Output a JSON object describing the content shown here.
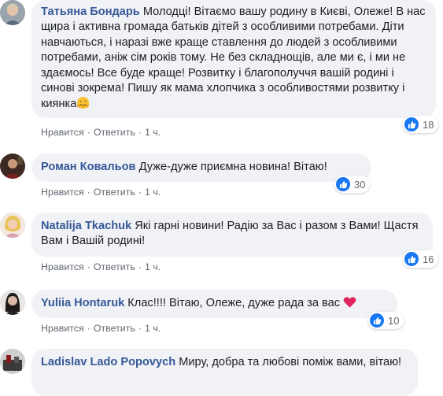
{
  "actions": {
    "like": "Нравится",
    "reply": "Ответить",
    "separator": "·"
  },
  "comments": [
    {
      "author": "Татьяна Бондарь",
      "text": "Молодці! Вітаємо вашу родину в Києві, Олеже! В нас щира і активна громада батьків дітей з особливими потребами. Діти навчаються, і наразі вже краще ставлення до людей з особливими потребами, аніж сім років тому. Не без складнощів, але ми є, і ми не здаємось! Все буде краще! Розвитку і благополуччя вашій родині і синові зокрема! Пишу як мама хлопчика з особливостями розвитку і киянка",
      "emoji": "hugging-face-icon",
      "time": "1 ч.",
      "reactions": "18"
    },
    {
      "author": "Роман Ковальов",
      "text": "Дуже-дуже приємна новина! Вітаю!",
      "time": "1 ч.",
      "reactions": "30"
    },
    {
      "author": "Natalija Tkachuk",
      "text": "Які гарні новини! Радію за Вас і разом з Вами! Щастя Вам і Вашій родині!",
      "time": "1 ч.",
      "reactions": "16"
    },
    {
      "author": "Yuliia Hontaruk",
      "text": "Клас!!!! Вітаю, Олеже, дуже рада за вас",
      "emoji": "red-heart-icon",
      "time": "1 ч.",
      "reactions": "10"
    },
    {
      "author": "Ladislav Lado Popovych",
      "text": "Миру, добра та любові поміж вами, вітаю!"
    }
  ],
  "colors": {
    "author": "#365899",
    "bubble": "#f0f2f5",
    "like_badge": "#1877f2",
    "heart": "#e0245e",
    "meta": "#606770"
  }
}
